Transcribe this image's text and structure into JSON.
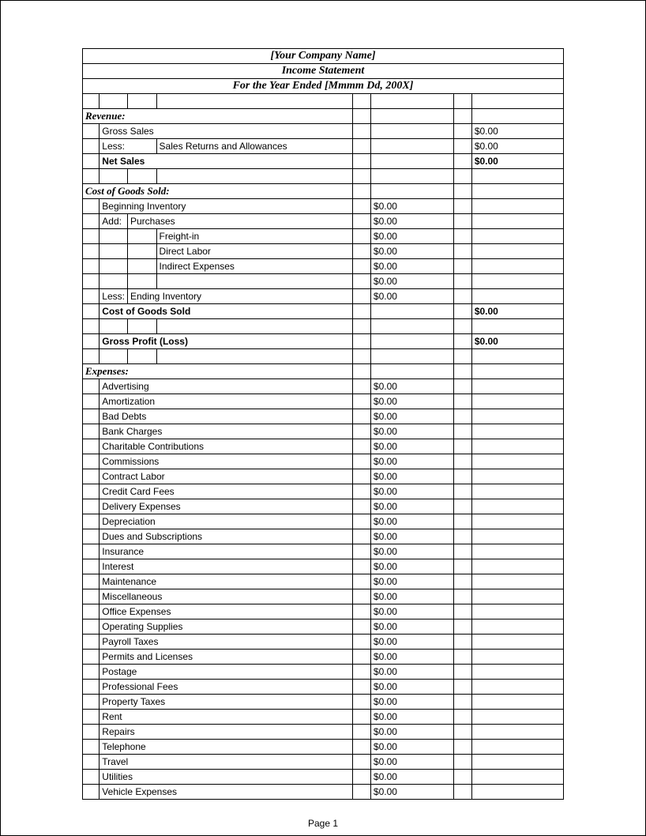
{
  "header": {
    "company": "[Your Company Name]",
    "title": "Income Statement",
    "period": "For the Year Ended [Mmmm Dd, 200X]"
  },
  "revenue": {
    "label": "Revenue:",
    "gross_sales": {
      "label": "Gross Sales",
      "value": "$0.00"
    },
    "less_label": "Less:",
    "returns": {
      "label": "Sales Returns and Allowances",
      "value": "$0.00"
    },
    "net_sales": {
      "label": "Net Sales",
      "value": "$0.00"
    }
  },
  "cogs": {
    "label": "Cost of Goods Sold:",
    "beginning_inventory": {
      "label": "Beginning Inventory",
      "value": "$0.00"
    },
    "add_label": "Add:",
    "purchases": {
      "label": "Purchases",
      "value": "$0.00"
    },
    "freight_in": {
      "label": "Freight-in",
      "value": "$0.00"
    },
    "direct_labor": {
      "label": "Direct Labor",
      "value": "$0.00"
    },
    "indirect_expenses": {
      "label": "Indirect Expenses",
      "value": "$0.00"
    },
    "subtotal_blank": {
      "value": "$0.00"
    },
    "less_label": "Less:",
    "ending_inventory": {
      "label": "Ending Inventory",
      "value": "$0.00"
    },
    "total": {
      "label": "Cost of Goods Sold",
      "value": "$0.00"
    },
    "gross_profit": {
      "label": "Gross Profit (Loss)",
      "value": "$0.00"
    }
  },
  "expenses": {
    "label": "Expenses:",
    "items": [
      {
        "label": "Advertising",
        "value": "$0.00"
      },
      {
        "label": "Amortization",
        "value": "$0.00"
      },
      {
        "label": "Bad Debts",
        "value": "$0.00"
      },
      {
        "label": "Bank Charges",
        "value": "$0.00"
      },
      {
        "label": "Charitable Contributions",
        "value": "$0.00"
      },
      {
        "label": "Commissions",
        "value": "$0.00"
      },
      {
        "label": "Contract Labor",
        "value": "$0.00"
      },
      {
        "label": "Credit Card Fees",
        "value": "$0.00"
      },
      {
        "label": "Delivery Expenses",
        "value": "$0.00"
      },
      {
        "label": "Depreciation",
        "value": "$0.00"
      },
      {
        "label": "Dues and Subscriptions",
        "value": "$0.00"
      },
      {
        "label": "Insurance",
        "value": "$0.00"
      },
      {
        "label": "Interest",
        "value": "$0.00"
      },
      {
        "label": "Maintenance",
        "value": "$0.00"
      },
      {
        "label": "Miscellaneous",
        "value": "$0.00"
      },
      {
        "label": "Office Expenses",
        "value": "$0.00"
      },
      {
        "label": "Operating Supplies",
        "value": "$0.00"
      },
      {
        "label": "Payroll Taxes",
        "value": "$0.00"
      },
      {
        "label": "Permits and Licenses",
        "value": "$0.00"
      },
      {
        "label": "Postage",
        "value": "$0.00"
      },
      {
        "label": "Professional Fees",
        "value": "$0.00"
      },
      {
        "label": "Property Taxes",
        "value": "$0.00"
      },
      {
        "label": "Rent",
        "value": "$0.00"
      },
      {
        "label": "Repairs",
        "value": "$0.00"
      },
      {
        "label": "Telephone",
        "value": "$0.00"
      },
      {
        "label": "Travel",
        "value": "$0.00"
      },
      {
        "label": "Utilities",
        "value": "$0.00"
      },
      {
        "label": "Vehicle Expenses",
        "value": "$0.00"
      }
    ]
  },
  "footer": {
    "page": "Page 1"
  }
}
